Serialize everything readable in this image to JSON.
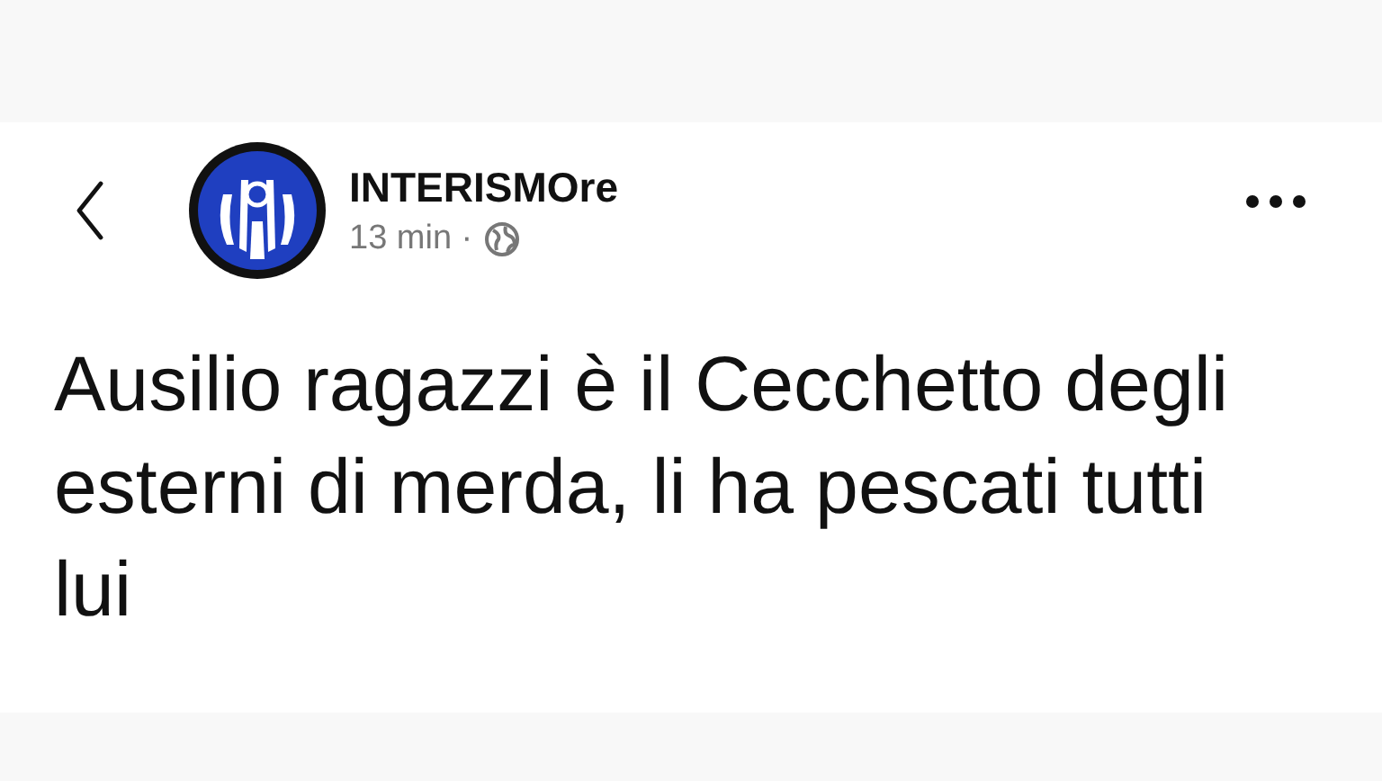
{
  "post": {
    "author": "INTERISMOre",
    "time": "13 min ·",
    "text": "Ausilio ragazzi è il Cecchetto degli esterni di merda, li ha pescati tutti lui"
  }
}
